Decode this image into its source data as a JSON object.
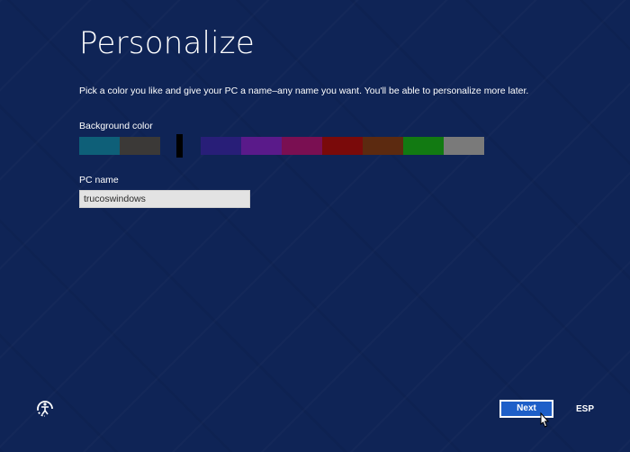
{
  "page": {
    "title": "Personalize",
    "subtitle": "Pick a color you like and give your PC a name–any name you want. You'll be able to personalize more later."
  },
  "background_color": {
    "label": "Background color",
    "swatches": [
      {
        "name": "teal",
        "color": "#0e5f78"
      },
      {
        "name": "dark-olive",
        "color": "#3b3937"
      },
      {
        "name": "navy",
        "color": "#0f2456",
        "selected": true
      },
      {
        "name": "indigo",
        "color": "#281e78"
      },
      {
        "name": "purple",
        "color": "#5a1a8a"
      },
      {
        "name": "magenta",
        "color": "#7a0f52"
      },
      {
        "name": "crimson",
        "color": "#7a0a0a"
      },
      {
        "name": "brown",
        "color": "#5c2a10"
      },
      {
        "name": "green",
        "color": "#127a12"
      },
      {
        "name": "gray",
        "color": "#7a7a7a"
      }
    ]
  },
  "pc_name": {
    "label": "PC name",
    "value": "trucoswindows"
  },
  "footer": {
    "next_label": "Next",
    "language": "ESP",
    "ease_of_access_icon": "ease-of-access-icon"
  },
  "colors": {
    "background": "#0f2456",
    "button": "#1e5fc8"
  }
}
